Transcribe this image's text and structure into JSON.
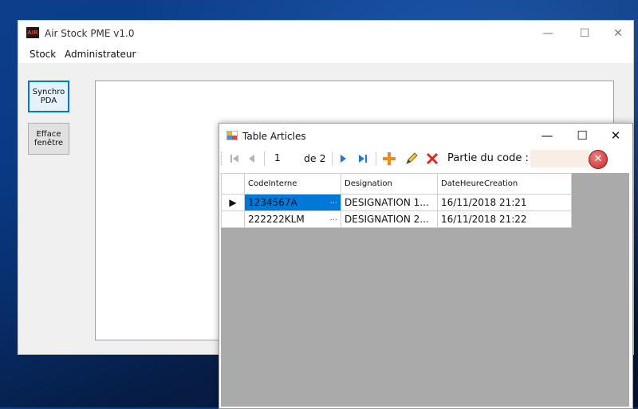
{
  "main_window": {
    "title": "Air Stock PME v1.0",
    "logo_text": "AIR",
    "controls": {
      "minimize": "—",
      "maximize": "☐",
      "close": "✕"
    },
    "menu": [
      "Stock",
      "Administrateur"
    ],
    "buttons": {
      "sync_line1": "Synchro",
      "sync_line2": "PDA",
      "clear_line1": "Efface",
      "clear_line2": "fenêtre"
    }
  },
  "child_window": {
    "title": "Table Articles",
    "controls": {
      "minimize": "—",
      "maximize": "☐",
      "close": "✕"
    },
    "toolbar": {
      "position": "1",
      "of_count": "de 2",
      "search_label": "Partie du code :",
      "search_value": ""
    },
    "grid": {
      "columns": [
        "CodeInterne",
        "Designation",
        "DateHeureCreation"
      ],
      "rows": [
        {
          "code": "1234567A",
          "designation": "DESIGNATION 1...",
          "date": "16/11/2018 21:21",
          "ellipsis": "..."
        },
        {
          "code": "222222KLM",
          "designation": "DESIGNATION 2...",
          "date": "16/11/2018 21:22",
          "ellipsis": "..."
        }
      ]
    }
  },
  "colors": {
    "selection": "#0078d7",
    "grid_background": "#aaaaaa",
    "search_bg": "#f9eee6"
  }
}
